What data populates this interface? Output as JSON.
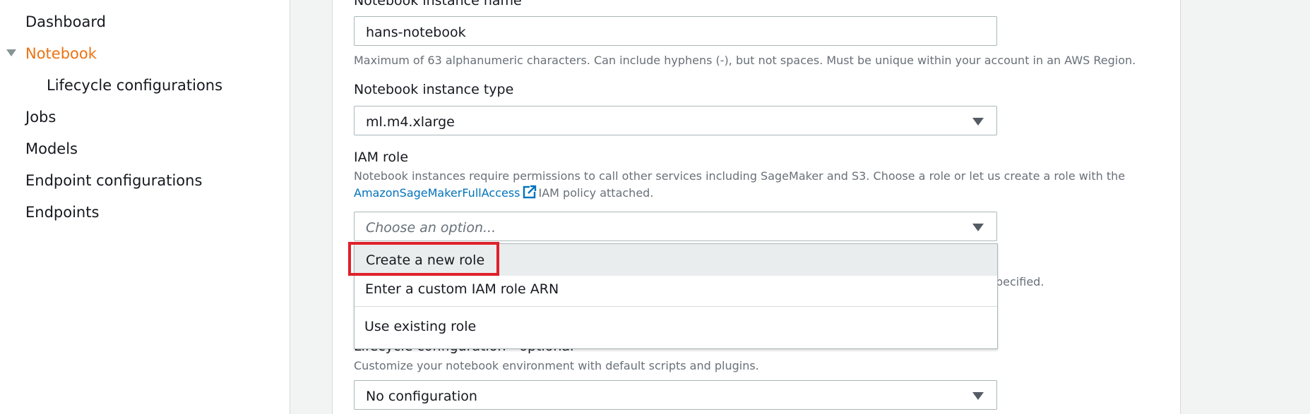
{
  "sidebar": {
    "items": [
      {
        "label": "Dashboard"
      },
      {
        "label": "Notebook",
        "active": true,
        "expanded": true
      },
      {
        "label": "Lifecycle configurations",
        "sub": true
      },
      {
        "label": "Jobs"
      },
      {
        "label": "Models"
      },
      {
        "label": "Endpoint configurations"
      },
      {
        "label": "Endpoints"
      }
    ]
  },
  "form": {
    "instance_name": {
      "label": "Notebook instance name",
      "value": "hans-notebook",
      "hint": "Maximum of 63 alphanumeric characters. Can include hyphens (-), but not spaces. Must be unique within your account in an AWS Region."
    },
    "instance_type": {
      "label": "Notebook instance type",
      "value": "ml.m4.xlarge"
    },
    "iam_role": {
      "label": "IAM role",
      "hint_line1": "Notebook instances require permissions to call other services including SageMaker and S3. Choose a role or let us create a role with the",
      "hint_link": "AmazonSageMakerFullAccess",
      "hint_suffix": "IAM policy attached.",
      "placeholder": "Choose an option...",
      "options": [
        "Create a new role",
        "Enter a custom IAM role ARN",
        "Use existing role"
      ],
      "hidden_tail": "pecified."
    },
    "lifecycle": {
      "label": "Lifecycle configuration - optional",
      "hint": "Customize your notebook environment with default scripts and plugins.",
      "value": "No configuration"
    }
  },
  "colors": {
    "accent_active": "#ec7211",
    "link": "#0073bb",
    "highlight": "#e0202a"
  },
  "icons": {
    "external_link": "external-link-icon",
    "caret": "caret-down-icon"
  }
}
